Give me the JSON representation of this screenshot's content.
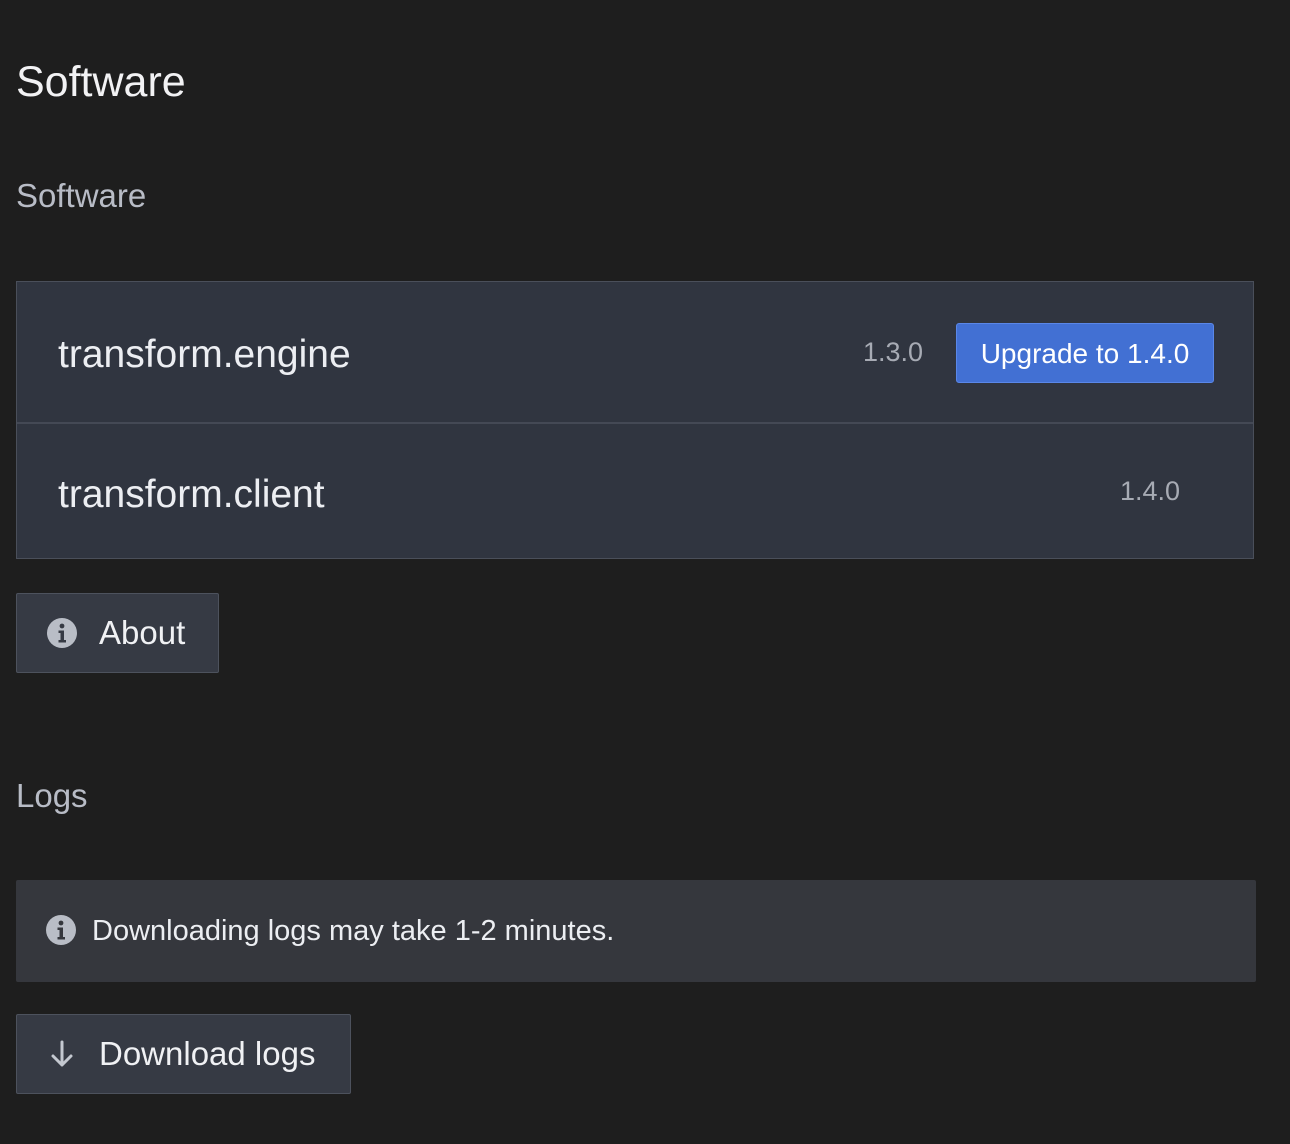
{
  "page": {
    "title": "Software"
  },
  "software_section": {
    "label": "Software",
    "packages": [
      {
        "name": "transform.engine",
        "version": "1.3.0",
        "upgrade_label": "Upgrade to 1.4.0"
      },
      {
        "name": "transform.client",
        "version": "1.4.0"
      }
    ],
    "about_button": {
      "label": "About",
      "icon": "info-circle-icon"
    }
  },
  "logs_section": {
    "label": "Logs",
    "notice": {
      "text": "Downloading logs may take 1-2 minutes.",
      "icon": "info-circle-icon"
    },
    "download_button": {
      "label": "Download logs",
      "icon": "arrow-down-icon"
    }
  },
  "colors": {
    "background": "#1e1e1e",
    "panel": "#303540",
    "accent": "#4270d3",
    "banner": "#35373d"
  }
}
